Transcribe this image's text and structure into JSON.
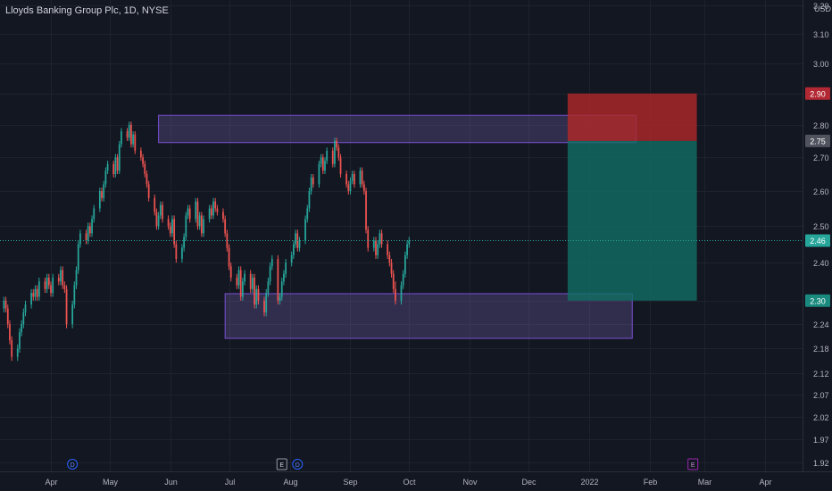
{
  "header": {
    "symbol_title": "Lloyds Banking Group Plc, 1D, NYSE",
    "currency": "USD"
  },
  "colors": {
    "background": "#131722",
    "grid": "#1e222d",
    "up": "#26a69a",
    "down": "#ef5350",
    "zone_border": "#7b4fd6",
    "zone_fill": "rgba(120,100,180,0.30)",
    "stop_fill": "rgba(178,40,40,0.80)",
    "target_fill": "rgba(18,110,100,0.80)",
    "axis_text": "#b2b5be",
    "last_price_line": "#26a69a"
  },
  "chart_data": {
    "type": "candlestick",
    "symbol": "Lloyds Banking Group Plc",
    "interval": "1D",
    "exchange": "NYSE",
    "y_axis": {
      "scale": "log",
      "tick_labels": [
        "3.20",
        "3.10",
        "3.00",
        "2.90",
        "2.80",
        "2.70",
        "2.60",
        "2.50",
        "2.40",
        "2.30",
        "2.24",
        "2.18",
        "2.12",
        "2.07",
        "2.02",
        "1.97",
        "1.92"
      ],
      "ticks": [
        3.2,
        3.1,
        3.0,
        2.9,
        2.8,
        2.7,
        2.6,
        2.5,
        2.4,
        2.3,
        2.24,
        2.18,
        2.12,
        2.07,
        2.02,
        1.97,
        1.92
      ],
      "range": [
        1.9,
        3.22
      ]
    },
    "x_axis": {
      "tick_labels": [
        "Apr",
        "May",
        "Jun",
        "Jul",
        "Aug",
        "Sep",
        "Oct",
        "Nov",
        "Dec",
        "2022",
        "Feb",
        "Mar",
        "Apr"
      ],
      "tick_dates": [
        "2021-04-01",
        "2021-05-01",
        "2021-06-01",
        "2021-07-01",
        "2021-08-01",
        "2021-09-01",
        "2021-10-01",
        "2021-11-01",
        "2021-12-01",
        "2022-01-01",
        "2022-02-01",
        "2022-03-01",
        "2022-04-01"
      ],
      "range": [
        "2021-03-06",
        "2022-04-20"
      ]
    },
    "price_labels": [
      {
        "value": 2.9,
        "text": "2.90",
        "role": "stop"
      },
      {
        "value": 2.75,
        "text": "2.75",
        "role": "entry"
      },
      {
        "value": 2.46,
        "text": "2.46",
        "role": "last"
      },
      {
        "value": 2.3,
        "text": "2.30",
        "role": "target"
      }
    ],
    "last_price": 2.46,
    "zones": [
      {
        "name": "resistance",
        "start": "2021-05-26",
        "end": "2022-01-25",
        "high": 2.83,
        "low": 2.745
      },
      {
        "name": "support",
        "start": "2021-06-29",
        "end": "2022-01-23",
        "high": 2.318,
        "low": 2.205
      }
    ],
    "position": {
      "type": "short",
      "start": "2021-12-21",
      "end": "2022-02-25",
      "entry": 2.75,
      "stop": 2.9,
      "target": 2.3
    },
    "markers": [
      {
        "letter": "D",
        "date": "2021-04-12"
      },
      {
        "letter": "E",
        "date": "2021-07-28"
      },
      {
        "letter": "D",
        "date": "2021-08-05"
      },
      {
        "letter": "E",
        "date": "2022-02-23"
      }
    ],
    "candles": {
      "start_date": "2021-03-08",
      "trading_days_only": true,
      "open": [
        2.28,
        2.3,
        2.28,
        2.24,
        2.2,
        2.16,
        2.18,
        2.22,
        2.24,
        2.27,
        2.29,
        2.32,
        2.31,
        2.33,
        2.31,
        2.35,
        2.33,
        2.36,
        2.34,
        2.32,
        2.36,
        2.35,
        2.38,
        2.34,
        2.33,
        2.24,
        2.29,
        2.34,
        2.38,
        2.45,
        2.48,
        2.46,
        2.5,
        2.48,
        2.52,
        2.55,
        2.6,
        2.58,
        2.62,
        2.66,
        2.68,
        2.65,
        2.7,
        2.66,
        2.74,
        2.78,
        2.76,
        2.8,
        2.74,
        2.77,
        2.72,
        2.7,
        2.68,
        2.65,
        2.62,
        2.58,
        2.54,
        2.5,
        2.53,
        2.56,
        2.52,
        2.5,
        2.48,
        2.52,
        2.45,
        2.41,
        2.44,
        2.47,
        2.53,
        2.55,
        2.52,
        2.57,
        2.5,
        2.53,
        2.48,
        2.52,
        2.55,
        2.53,
        2.57,
        2.55,
        2.54,
        2.52,
        2.48,
        2.44,
        2.39,
        2.36,
        2.34,
        2.38,
        2.31,
        2.35,
        2.37,
        2.33,
        2.36,
        2.29,
        2.33,
        2.3,
        2.27,
        2.32,
        2.35,
        2.39,
        2.41,
        2.3,
        2.31,
        2.35,
        2.37,
        2.4,
        2.42,
        2.45,
        2.48,
        2.44,
        2.46,
        2.52,
        2.55,
        2.6,
        2.64,
        2.62,
        2.68,
        2.7,
        2.66,
        2.69,
        2.72,
        2.68,
        2.75,
        2.73,
        2.7,
        2.65,
        2.62,
        2.6,
        2.63,
        2.65,
        2.62,
        2.66,
        2.62,
        2.6,
        2.49,
        2.44,
        2.46,
        2.42,
        2.45,
        2.48,
        2.45,
        2.42,
        2.4,
        2.37,
        2.33,
        2.3,
        2.34,
        2.37,
        2.42,
        2.45
      ],
      "close": [
        2.3,
        2.28,
        2.24,
        2.2,
        2.16,
        2.18,
        2.22,
        2.24,
        2.27,
        2.29,
        2.32,
        2.31,
        2.33,
        2.31,
        2.35,
        2.33,
        2.36,
        2.34,
        2.32,
        2.36,
        2.35,
        2.38,
        2.34,
        2.33,
        2.24,
        2.29,
        2.34,
        2.38,
        2.45,
        2.48,
        2.46,
        2.5,
        2.48,
        2.52,
        2.55,
        2.6,
        2.58,
        2.62,
        2.66,
        2.68,
        2.65,
        2.7,
        2.66,
        2.74,
        2.78,
        2.76,
        2.8,
        2.74,
        2.77,
        2.72,
        2.7,
        2.68,
        2.65,
        2.62,
        2.58,
        2.54,
        2.5,
        2.53,
        2.56,
        2.52,
        2.5,
        2.48,
        2.52,
        2.45,
        2.41,
        2.44,
        2.47,
        2.53,
        2.55,
        2.52,
        2.57,
        2.5,
        2.53,
        2.48,
        2.52,
        2.55,
        2.53,
        2.57,
        2.55,
        2.54,
        2.52,
        2.48,
        2.44,
        2.39,
        2.36,
        2.34,
        2.38,
        2.31,
        2.35,
        2.37,
        2.33,
        2.36,
        2.29,
        2.33,
        2.3,
        2.27,
        2.32,
        2.35,
        2.39,
        2.41,
        2.3,
        2.31,
        2.35,
        2.37,
        2.4,
        2.42,
        2.45,
        2.48,
        2.44,
        2.46,
        2.52,
        2.55,
        2.6,
        2.64,
        2.62,
        2.68,
        2.7,
        2.66,
        2.69,
        2.72,
        2.68,
        2.75,
        2.73,
        2.7,
        2.65,
        2.62,
        2.6,
        2.63,
        2.65,
        2.62,
        2.66,
        2.62,
        2.6,
        2.49,
        2.44,
        2.46,
        2.42,
        2.45,
        2.48,
        2.45,
        2.42,
        2.4,
        2.37,
        2.33,
        2.3,
        2.34,
        2.37,
        2.42,
        2.45,
        2.46
      ],
      "high": [
        2.31,
        2.31,
        2.29,
        2.25,
        2.21,
        2.19,
        2.23,
        2.25,
        2.28,
        2.3,
        2.33,
        2.33,
        2.34,
        2.34,
        2.36,
        2.36,
        2.37,
        2.37,
        2.35,
        2.37,
        2.37,
        2.39,
        2.39,
        2.35,
        2.34,
        2.3,
        2.35,
        2.39,
        2.46,
        2.49,
        2.49,
        2.51,
        2.51,
        2.53,
        2.56,
        2.61,
        2.61,
        2.63,
        2.67,
        2.69,
        2.69,
        2.71,
        2.71,
        2.75,
        2.79,
        2.79,
        2.81,
        2.81,
        2.78,
        2.78,
        2.73,
        2.71,
        2.69,
        2.66,
        2.63,
        2.59,
        2.55,
        2.54,
        2.57,
        2.57,
        2.53,
        2.51,
        2.53,
        2.53,
        2.46,
        2.45,
        2.48,
        2.54,
        2.56,
        2.56,
        2.58,
        2.58,
        2.54,
        2.54,
        2.53,
        2.56,
        2.56,
        2.58,
        2.58,
        2.56,
        2.55,
        2.53,
        2.49,
        2.45,
        2.4,
        2.37,
        2.39,
        2.39,
        2.36,
        2.38,
        2.38,
        2.37,
        2.37,
        2.34,
        2.34,
        2.31,
        2.33,
        2.36,
        2.4,
        2.42,
        2.42,
        2.32,
        2.36,
        2.38,
        2.41,
        2.43,
        2.46,
        2.49,
        2.49,
        2.47,
        2.53,
        2.56,
        2.61,
        2.65,
        2.65,
        2.69,
        2.71,
        2.71,
        2.7,
        2.73,
        2.73,
        2.76,
        2.76,
        2.74,
        2.71,
        2.66,
        2.63,
        2.64,
        2.66,
        2.66,
        2.67,
        2.67,
        2.63,
        2.61,
        2.5,
        2.47,
        2.47,
        2.46,
        2.49,
        2.49,
        2.46,
        2.43,
        2.41,
        2.38,
        2.35,
        2.35,
        2.38,
        2.43,
        2.46,
        2.47
      ],
      "low": [
        2.27,
        2.27,
        2.23,
        2.19,
        2.15,
        2.15,
        2.17,
        2.21,
        2.23,
        2.26,
        2.28,
        2.3,
        2.3,
        2.3,
        2.3,
        2.32,
        2.32,
        2.33,
        2.31,
        2.31,
        2.34,
        2.34,
        2.33,
        2.32,
        2.23,
        2.23,
        2.28,
        2.33,
        2.37,
        2.44,
        2.45,
        2.45,
        2.47,
        2.47,
        2.51,
        2.54,
        2.57,
        2.57,
        2.61,
        2.65,
        2.64,
        2.64,
        2.65,
        2.65,
        2.73,
        2.75,
        2.75,
        2.73,
        2.73,
        2.71,
        2.69,
        2.67,
        2.64,
        2.61,
        2.57,
        2.53,
        2.49,
        2.49,
        2.52,
        2.51,
        2.49,
        2.47,
        2.47,
        2.44,
        2.4,
        2.4,
        2.43,
        2.46,
        2.52,
        2.51,
        2.51,
        2.49,
        2.49,
        2.47,
        2.47,
        2.51,
        2.52,
        2.52,
        2.54,
        2.53,
        2.51,
        2.47,
        2.43,
        2.38,
        2.35,
        2.33,
        2.33,
        2.3,
        2.3,
        2.34,
        2.32,
        2.32,
        2.28,
        2.28,
        2.29,
        2.26,
        2.26,
        2.31,
        2.34,
        2.38,
        2.29,
        2.29,
        2.3,
        2.34,
        2.36,
        2.39,
        2.41,
        2.44,
        2.43,
        2.43,
        2.45,
        2.51,
        2.54,
        2.59,
        2.61,
        2.61,
        2.67,
        2.65,
        2.65,
        2.68,
        2.67,
        2.67,
        2.72,
        2.69,
        2.64,
        2.61,
        2.59,
        2.59,
        2.62,
        2.61,
        2.61,
        2.61,
        2.59,
        2.48,
        2.43,
        2.43,
        2.41,
        2.41,
        2.44,
        2.44,
        2.41,
        2.39,
        2.36,
        2.32,
        2.29,
        2.29,
        2.33,
        2.36,
        2.41,
        2.44
      ]
    }
  }
}
